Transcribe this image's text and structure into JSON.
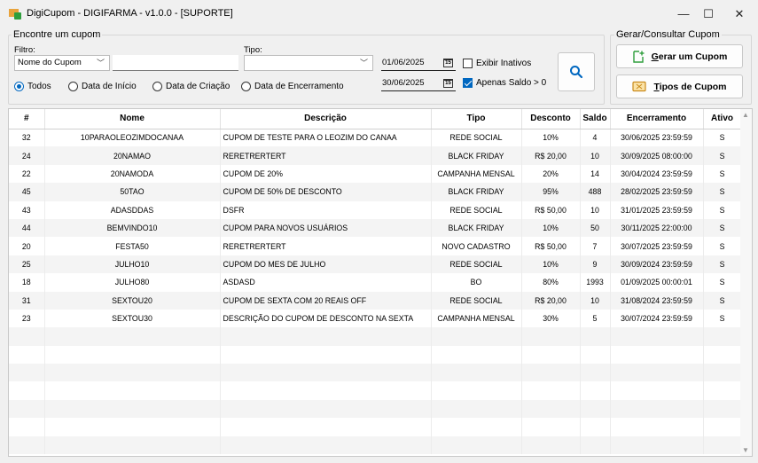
{
  "window": {
    "title": "DigiCupom - DIGIFARMA - v1.0.0 - [SUPORTE]",
    "minimize": "—",
    "maximize": "☐",
    "close": "✕"
  },
  "search_panel": {
    "group_label": "Encontre um cupom",
    "filter_label": "Filtro:",
    "filter_value": "Nome do Cupom",
    "filter_text": "",
    "type_label": "Tipo:",
    "type_value": "",
    "date_start": "01/06/2025",
    "date_end": "30/06/2025",
    "show_inactive_label": "Exibir Inativos",
    "show_inactive_checked": false,
    "only_balance_label": "Apenas Saldo > 0",
    "only_balance_checked": true,
    "radios": [
      {
        "label": "Todos",
        "selected": true
      },
      {
        "label": "Data de Início",
        "selected": false
      },
      {
        "label": "Data de Criação",
        "selected": false
      },
      {
        "label": "Data de Encerramento",
        "selected": false
      }
    ],
    "search_icon": "search-icon"
  },
  "actions_panel": {
    "group_label": "Gerar/Consultar Cupom",
    "generate_mnemonic": "G",
    "generate_rest": "erar um Cupom",
    "types_mnemonic": "T",
    "types_rest": "ipos de Cupom"
  },
  "colors": {
    "accent": "#0067c0",
    "icon_green": "#2e9e3c",
    "icon_orange": "#e8a33c"
  },
  "table": {
    "columns": [
      "#",
      "Nome",
      "Descrição",
      "Tipo",
      "Desconto",
      "Saldo",
      "Encerramento",
      "Ativo"
    ],
    "rows": [
      [
        "32",
        "10PARAOLEOZIMDOCANAA",
        "CUPOM DE TESTE PARA O LEOZIM DO CANAA",
        "REDE SOCIAL",
        "10%",
        "4",
        "30/06/2025 23:59:59",
        "S"
      ],
      [
        "24",
        "20NAMAO",
        "RERETRERTERT",
        "BLACK FRIDAY",
        "R$ 20,00",
        "10",
        "30/09/2025 08:00:00",
        "S"
      ],
      [
        "22",
        "20NAMODA",
        "CUPOM DE 20%",
        "CAMPANHA MENSAL",
        "20%",
        "14",
        "30/04/2024 23:59:59",
        "S"
      ],
      [
        "45",
        "50TAO",
        "CUPOM DE 50% DE DESCONTO",
        "BLACK FRIDAY",
        "95%",
        "488",
        "28/02/2025 23:59:59",
        "S"
      ],
      [
        "43",
        "ADASDDAS",
        "DSFR",
        "REDE SOCIAL",
        "R$ 50,00",
        "10",
        "31/01/2025 23:59:59",
        "S"
      ],
      [
        "44",
        "BEMVINDO10",
        "CUPOM PARA NOVOS USUÁRIOS",
        "BLACK FRIDAY",
        "10%",
        "50",
        "30/11/2025 22:00:00",
        "S"
      ],
      [
        "20",
        "FESTA50",
        "RERETRERTERT",
        "NOVO CADASTRO",
        "R$ 50,00",
        "7",
        "30/07/2025 23:59:59",
        "S"
      ],
      [
        "25",
        "JULHO10",
        "CUPOM DO MES DE JULHO",
        "REDE SOCIAL",
        "10%",
        "9",
        "30/09/2024 23:59:59",
        "S"
      ],
      [
        "18",
        "JULHO80",
        "ASDASD",
        "BO",
        "80%",
        "1993",
        "01/09/2025 00:00:01",
        "S"
      ],
      [
        "31",
        "SEXTOU20",
        "CUPOM DE SEXTA COM 20 REAIS OFF",
        "REDE SOCIAL",
        "R$ 20,00",
        "10",
        "31/08/2024 23:59:59",
        "S"
      ],
      [
        "23",
        "SEXTOU30",
        "DESCRIÇÃO DO CUPOM DE DESCONTO NA SEXTA",
        "CAMPANHA MENSAL",
        "30%",
        "5",
        "30/07/2024 23:59:59",
        "S"
      ]
    ]
  }
}
